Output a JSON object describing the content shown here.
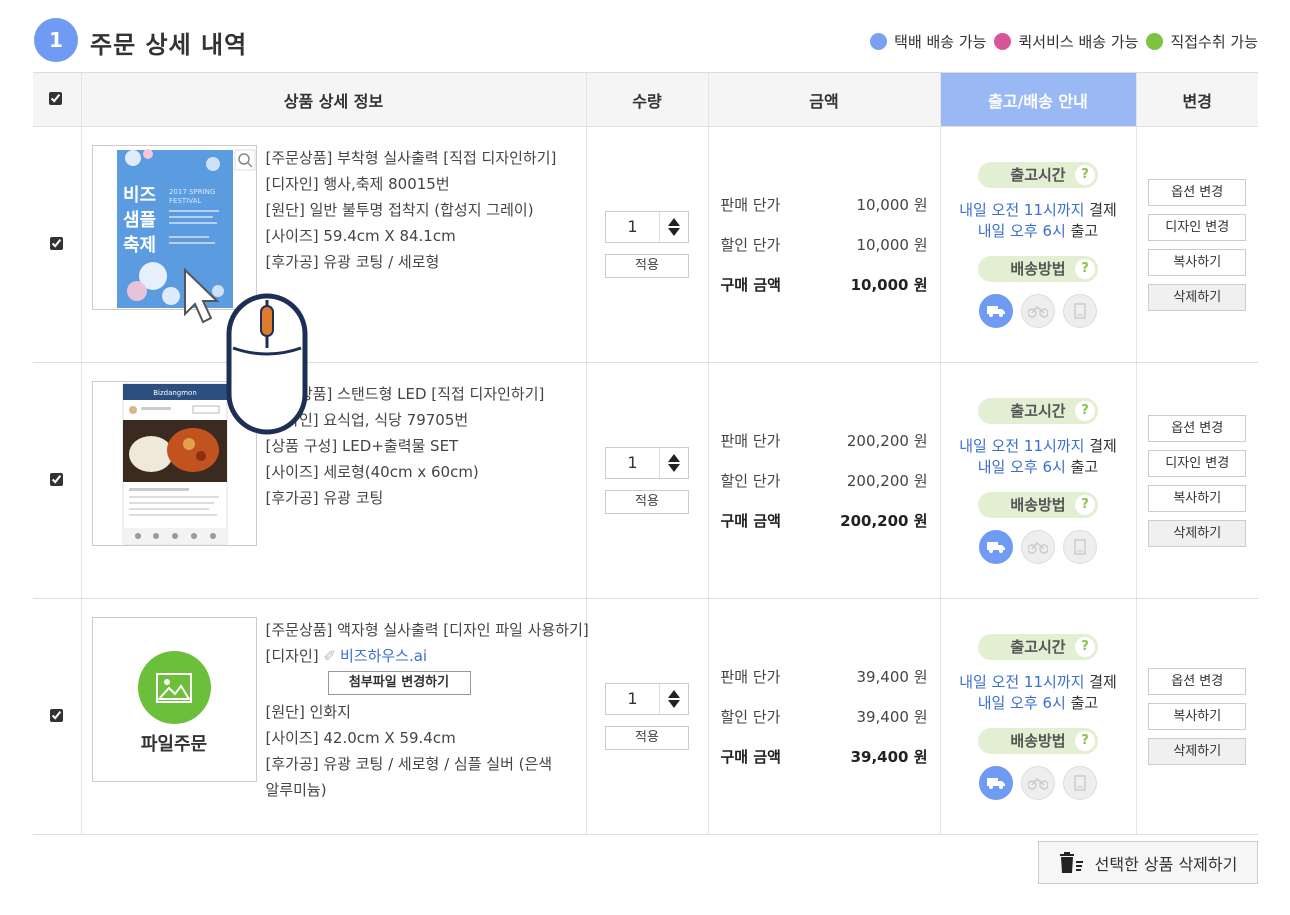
{
  "header": {
    "step": "1",
    "title": "주문 상세 내역",
    "legend": [
      {
        "label": "택배 배송 가능",
        "color": "#7aa0ef"
      },
      {
        "label": "퀵서비스 배송 가능",
        "color": "#d9559a"
      },
      {
        "label": "직접수취 가능",
        "color": "#7ec242"
      }
    ]
  },
  "table": {
    "headers": {
      "info": "상품 상세 정보",
      "qty": "수량",
      "price": "금액",
      "ship": "출고/배송 안내",
      "change": "변경"
    }
  },
  "shipping": {
    "time_label": "출고시간",
    "method_label": "배송방법",
    "help": "?",
    "line1_blue": "내일 오전 11시까지",
    "line1_rest": " 결제",
    "line2_blue": "내일 오후 6시",
    "line2_rest": " 출고"
  },
  "price_labels": {
    "unit": "판매 단가",
    "discount": "할인 단가",
    "total": "구매 금액"
  },
  "apply_label": "적용",
  "items": [
    {
      "options": [
        "[주문상품] 부착형 실사출력 [직접 디자인하기]",
        "[디자인] 행사,축제 80015번",
        "[원단] 일반 불투명 접착지 (합성지 그레이)",
        "[사이즈] 59.4cm X 84.1cm",
        "[후가공] 유광 코팅 / 세로형"
      ],
      "poster_title": "비즈 샘플 축제",
      "poster_sub": "2017 SPRING FESTIVAL",
      "qty": "1",
      "unit_price": "10,000 원",
      "discount_price": "10,000 원",
      "total_price": "10,000 원",
      "buttons": [
        "옵션 변경",
        "디자인 변경",
        "복사하기",
        "삭제하기"
      ]
    },
    {
      "options": [
        "[주문상품] 스탠드형 LED [직접 디자인하기]",
        "[디자인] 요식업, 식당 79705번",
        "[상품 구성] LED+출력물 SET",
        "[사이즈] 세로형(40cm x 60cm)",
        "[후가공] 유광 코팅"
      ],
      "app_name": "Bizdangmon",
      "qty": "1",
      "unit_price": "200,200 원",
      "discount_price": "200,200 원",
      "total_price": "200,200 원",
      "buttons": [
        "옵션 변경",
        "디자인 변경",
        "복사하기",
        "삭제하기"
      ]
    },
    {
      "option_first": "[주문상품] 액자형 실사출력 [디자인 파일 사용하기]",
      "design_label": "[디자인]",
      "file_name": "비즈하우스.ai",
      "attach_label": "첨부파일 변경하기",
      "options_rest": [
        "[원단] 인화지",
        "[사이즈] 42.0cm X 59.4cm",
        "[후가공] 유광 코팅 / 세로형 / 심플 실버 (은색",
        "알루미늄)"
      ],
      "thumb_label": "파일주문",
      "qty": "1",
      "unit_price": "39,400 원",
      "discount_price": "39,400 원",
      "total_price": "39,400 원",
      "buttons": [
        "옵션 변경",
        "복사하기",
        "삭제하기"
      ]
    }
  ],
  "delete_selected": "선택한 상품 삭제하기"
}
